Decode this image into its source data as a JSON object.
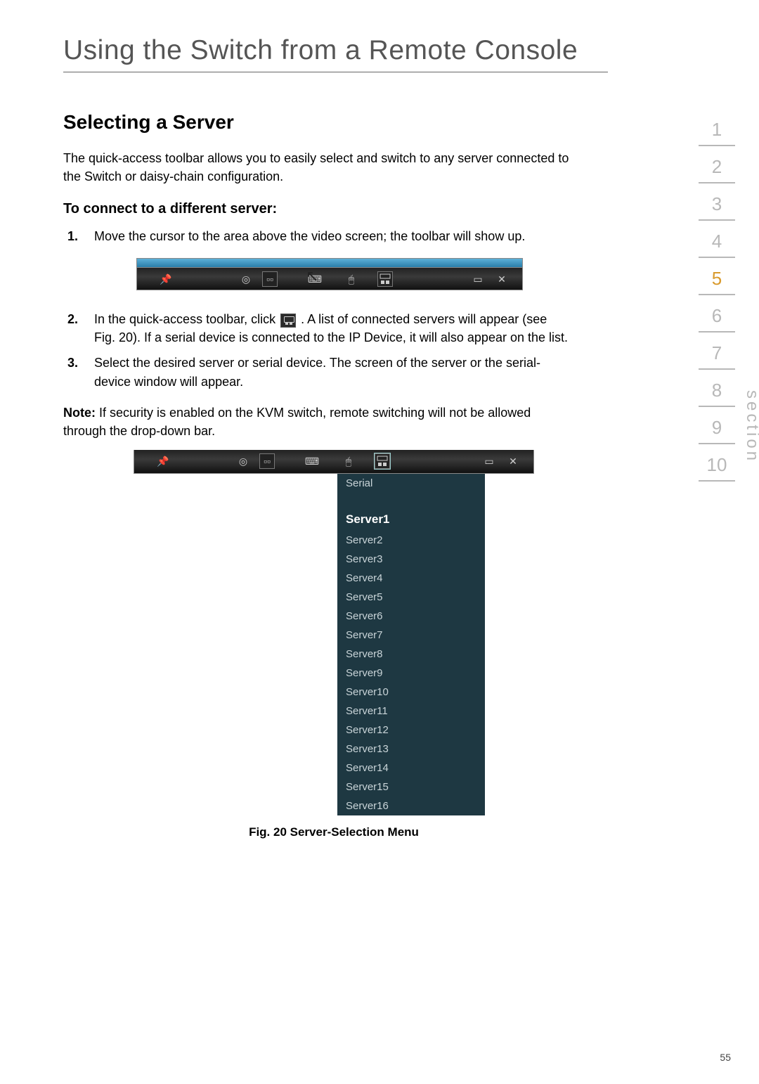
{
  "page_title": "Using the Switch from a Remote Console",
  "h2": "Selecting a Server",
  "intro": "The quick-access toolbar allows you to easily select and switch to any server connected to the Switch or daisy-chain configuration.",
  "h3": "To connect to a different server:",
  "steps": {
    "s1_num": "1.",
    "s1": "Move the cursor to the area above the video screen; the toolbar will show up.",
    "s2_num": "2.",
    "s2a": "In the quick-access toolbar, click ",
    "s2b": ". A list of connected servers will appear (see Fig. 20). If a serial device is connected to the IP Device, it will also appear on the list.",
    "s3_num": "3.",
    "s3": "Select the desired server or serial device. The screen of the server or the serial-device window will appear."
  },
  "note_label": "Note:",
  "note_text": " If security is enabled on the KVM switch, remote switching will not be allowed through the drop-down bar.",
  "dropdown": {
    "serial": "Serial",
    "current": "Server1",
    "items": [
      "Server2",
      "Server3",
      "Server4",
      "Server5",
      "Server6",
      "Server7",
      "Server8",
      "Server9",
      "Server10",
      "Server11",
      "Server12",
      "Server13",
      "Server14",
      "Server15",
      "Server16"
    ]
  },
  "caption": "Fig. 20 Server-Selection Menu",
  "sections": [
    "1",
    "2",
    "3",
    "4",
    "5",
    "6",
    "7",
    "8",
    "9",
    "10"
  ],
  "active_section": "5",
  "section_label": "section",
  "page_number": "55"
}
